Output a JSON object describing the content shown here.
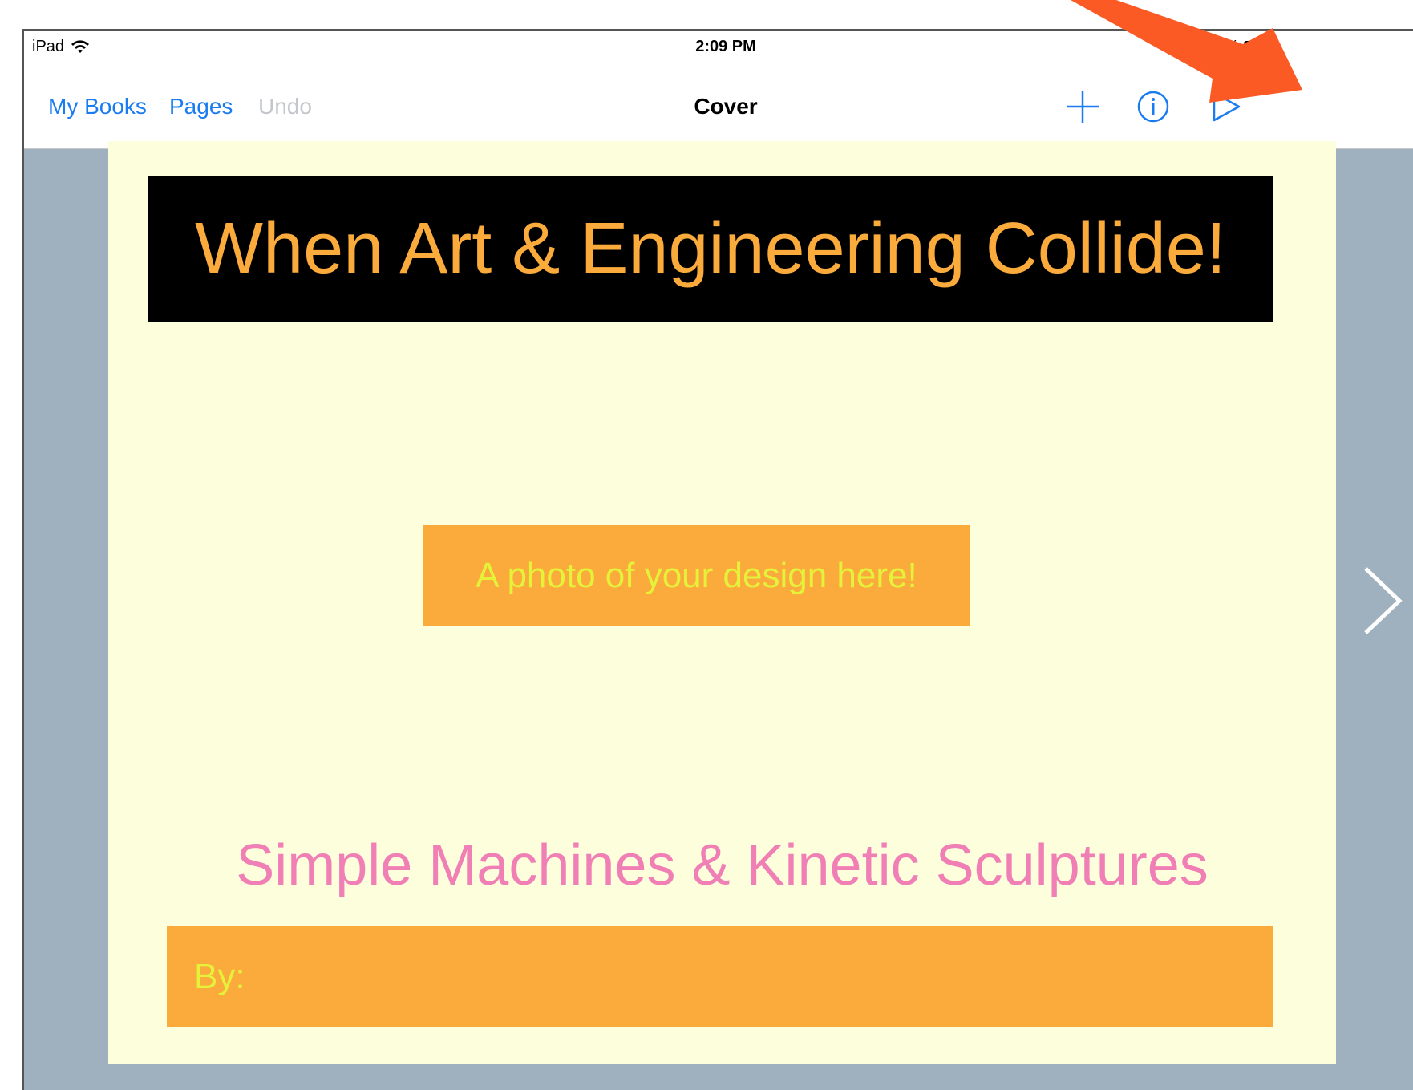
{
  "status_bar": {
    "device": "iPad",
    "time": "2:09 PM",
    "battery": "55%",
    "battery_level": 0.55
  },
  "nav": {
    "my_books": "My Books",
    "pages": "Pages",
    "undo": "Undo",
    "title": "Cover"
  },
  "page": {
    "title": "When Art & Engineering Collide!",
    "photo_placeholder": "A photo of your design here!",
    "subtitle": "Simple Machines & Kinetic Sculptures",
    "by_label": "By:"
  },
  "colors": {
    "accent_blue": "#1a7cf0",
    "page_bg": "#fdfedc",
    "orange": "#fbab3c",
    "yellow_text": "#e5f23a",
    "pink_text": "#f07fb5",
    "annotation_arrow": "#fb5a24"
  }
}
